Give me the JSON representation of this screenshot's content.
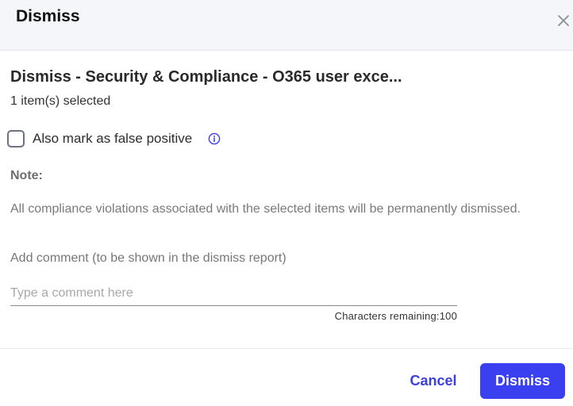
{
  "dialog": {
    "title": "Dismiss",
    "close_icon": "close-icon"
  },
  "content": {
    "item_title": "Dismiss - Security & Compliance - O365 user exce...",
    "selected_count": "1 item(s) selected",
    "false_positive": {
      "label": "Also mark as false positive",
      "checked": false,
      "info_icon": "info-icon"
    },
    "note": {
      "heading": "Note:",
      "body": "All compliance violations associated with the selected items will be permanently dismissed."
    },
    "comment": {
      "label": "Add comment (to be shown in the dismiss report)",
      "placeholder": "Type a comment here",
      "value": "",
      "chars_remaining_label": "Characters remaining:",
      "chars_remaining_value": "100"
    }
  },
  "footer": {
    "cancel_label": "Cancel",
    "dismiss_label": "Dismiss"
  },
  "colors": {
    "accent": "#3a3fef",
    "header_bg": "#f4f6f9"
  }
}
